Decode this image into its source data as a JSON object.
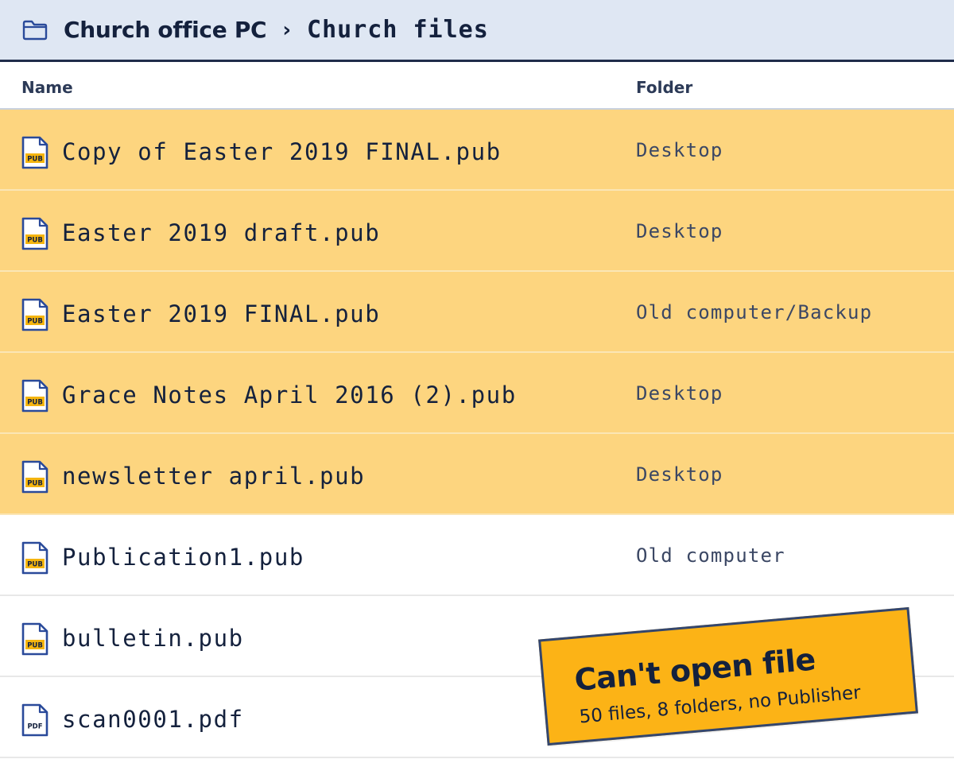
{
  "breadcrumb": {
    "root": "Church office PC",
    "separator": "›",
    "current": "Church files"
  },
  "columns": {
    "name": "Name",
    "folder": "Folder"
  },
  "files": [
    {
      "name": "Copy of Easter 2019 FINAL.pub",
      "folder": "Desktop",
      "type": "PUB",
      "selected": true
    },
    {
      "name": "Easter 2019 draft.pub",
      "folder": "Desktop",
      "type": "PUB",
      "selected": true
    },
    {
      "name": "Easter 2019 FINAL.pub",
      "folder": "Old computer/Backup",
      "type": "PUB",
      "selected": true
    },
    {
      "name": "Grace Notes April 2016 (2).pub",
      "folder": "Desktop",
      "type": "PUB",
      "selected": true
    },
    {
      "name": "newsletter april.pub",
      "folder": "Desktop",
      "type": "PUB",
      "selected": true
    },
    {
      "name": "Publication1.pub",
      "folder": "Old computer",
      "type": "PUB",
      "selected": false
    },
    {
      "name": "bulletin.pub",
      "folder": "",
      "type": "PUB",
      "selected": false
    },
    {
      "name": "scan0001.pdf",
      "folder": "",
      "type": "PDF",
      "selected": false
    }
  ],
  "banner": {
    "title": "Can't open file",
    "subtitle": "50 files, 8 folders, no Publisher"
  },
  "icons": {
    "titlebar": "folder-icon",
    "pub": "pub-file-icon",
    "pdf": "pdf-file-icon"
  },
  "colors": {
    "selected_row": "#fdd57f",
    "banner": "#fcb316",
    "titlebar_bg": "#dfe7f3",
    "ink": "#14213d",
    "icon_stroke": "#2a4a9a",
    "pub_badge": "#f5b50f"
  }
}
